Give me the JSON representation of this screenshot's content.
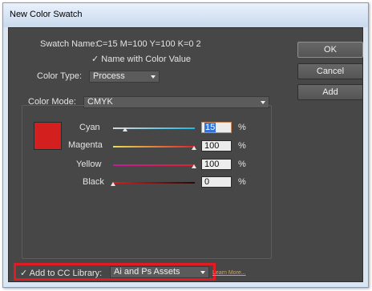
{
  "window": {
    "title": "New Color Swatch"
  },
  "swatch": {
    "name_label": "Swatch Name:",
    "name_value": "C=15 M=100 Y=100 K=0 2",
    "name_with_color_value_label": "Name with Color Value",
    "name_with_color_value_checked": true,
    "color": "#d41f1f"
  },
  "color_type": {
    "label": "Color Type:",
    "value": "Process"
  },
  "color_mode": {
    "label": "Color Mode:",
    "value": "CMYK"
  },
  "channels": [
    {
      "label": "Cyan",
      "value": "15",
      "level": 0.15,
      "unit": "%"
    },
    {
      "label": "Magenta",
      "value": "100",
      "level": 1.0,
      "unit": "%"
    },
    {
      "label": "Yellow",
      "value": "100",
      "level": 1.0,
      "unit": "%"
    },
    {
      "label": "Black",
      "value": "0",
      "level": 0.0,
      "unit": "%"
    }
  ],
  "buttons": {
    "ok": "OK",
    "cancel": "Cancel",
    "add": "Add"
  },
  "cc_library": {
    "checked": true,
    "label": "Add to CC Library:",
    "value": "Ai and Ps Assets",
    "learn_more": "Learn More..."
  },
  "colors": {
    "panel_bg": "#474747",
    "highlight": "#e01b24",
    "link": "#e0a040"
  }
}
